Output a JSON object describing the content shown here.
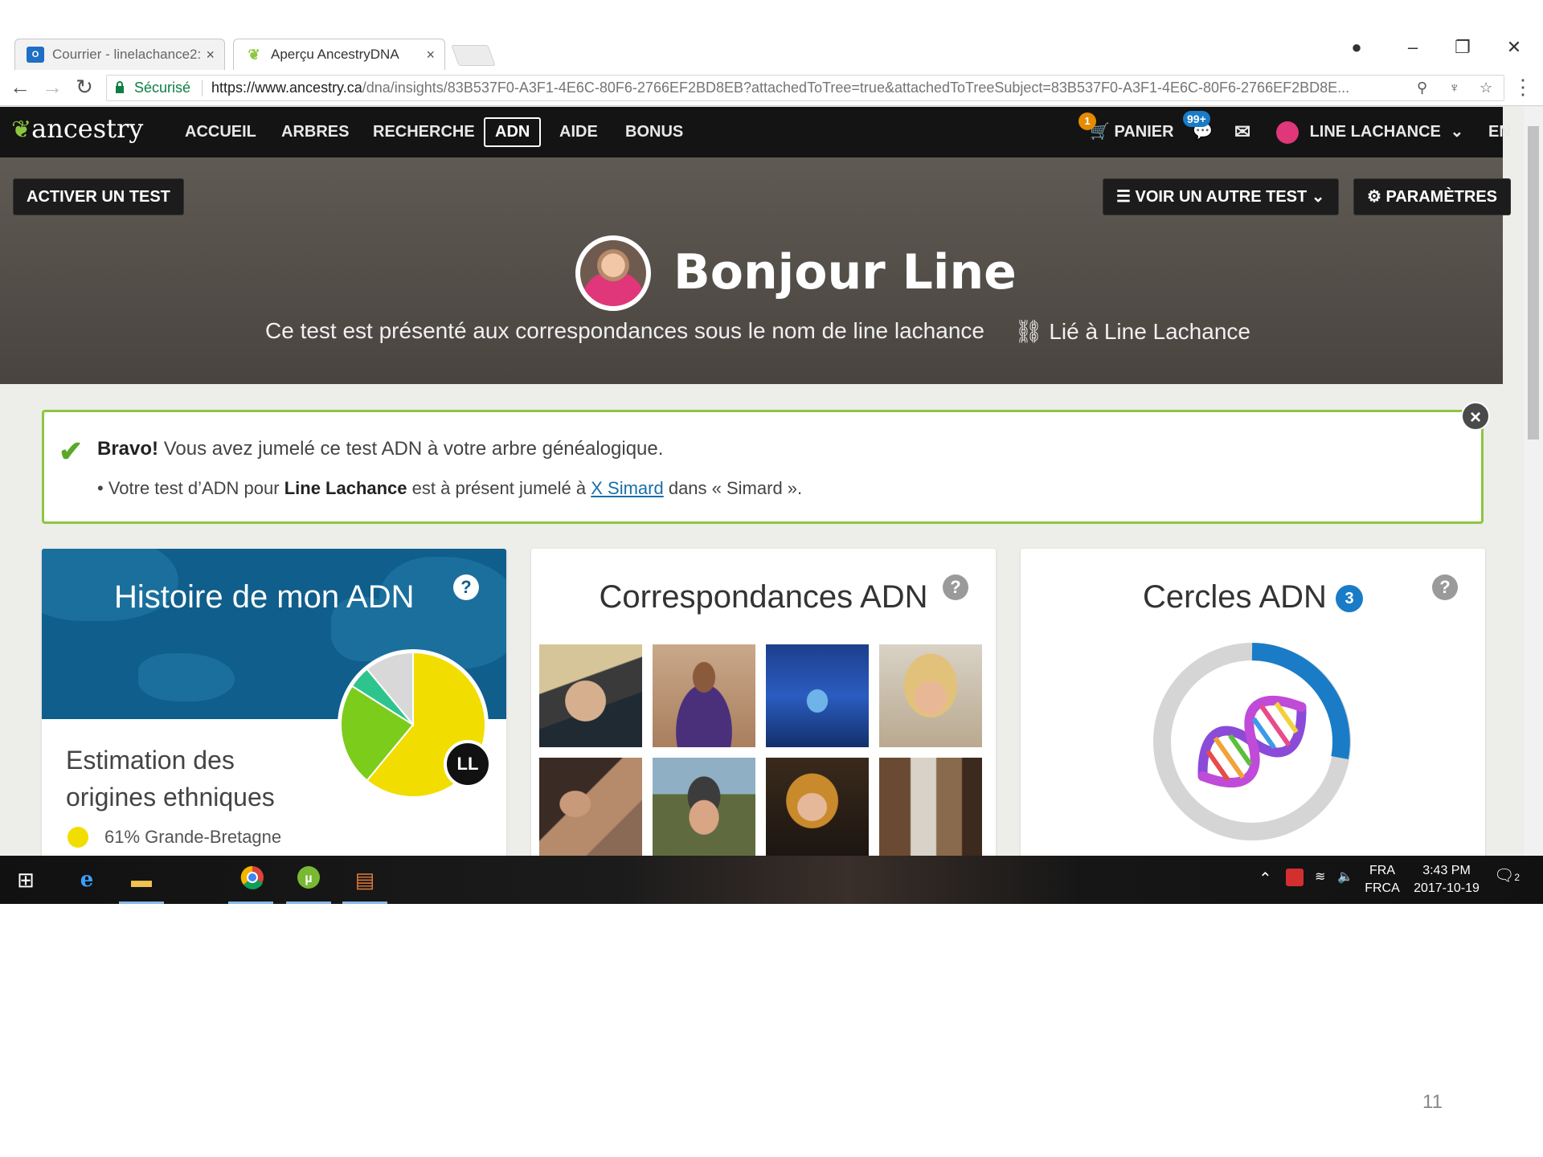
{
  "browser": {
    "tabs": [
      {
        "label": "Courrier - linelachance2:",
        "icon": "outlook-icon",
        "active": false
      },
      {
        "label": "Aperçu AncestryDNA",
        "icon": "ancestry-leaf-icon",
        "active": true
      }
    ],
    "secure_label": "Sécurisé",
    "url_host": "https://www.ancestry.ca",
    "url_rest": "/dna/insights/83B537F0-A3F1-4E6C-80F6-2766EF2BD8EB?attachedToTree=true&attachedToTreeSubject=83B537F0-A3F1-4E6C-80F6-2766EF2BD8E..."
  },
  "header": {
    "logo": "ancestry",
    "nav": [
      "ACCUEIL",
      "ARBRES",
      "RECHERCHE",
      "ADN",
      "AIDE",
      "BONUS"
    ],
    "active_nav": "ADN",
    "cart_label": "PANIER",
    "cart_badge": "1",
    "messages_badge": "99+",
    "user_name": "LINE LACHANCE",
    "language": "EN"
  },
  "hero": {
    "activate_button": "ACTIVER UN TEST",
    "other_test_button": "VOIR UN AUTRE TEST",
    "settings_button": "PARAMÈTRES",
    "greeting": "Bonjour Line",
    "subtitle": "Ce test est présenté aux correspondances sous le nom de line lachance",
    "linked_label": "Lié à Line Lachance"
  },
  "alert": {
    "bold": "Bravo!",
    "line1_rest": " Vous avez jumelé ce test ADN à votre arbre généalogique.",
    "line2_prefix": "• Votre test d’ADN pour ",
    "line2_name": "Line Lachance",
    "line2_mid": " est à présent jumelé à ",
    "line2_link": "X Simard",
    "line2_suffix": " dans « Simard »."
  },
  "cards": {
    "history": {
      "title": "Histoire de mon ADN",
      "subtitle": "Estimation des origines ethniques",
      "initials": "LL",
      "legend": "61% Grande-Bretagne",
      "pie": [
        {
          "label": "Grande-Bretagne",
          "value": 61,
          "color": "#f2dd00"
        },
        {
          "label": "",
          "value": 23,
          "color": "#7ccc1c"
        },
        {
          "label": "",
          "value": 5,
          "color": "#2ec48e"
        },
        {
          "label": "",
          "value": 11,
          "color": "#d8d8d8"
        }
      ]
    },
    "matches": {
      "title": "Correspondances ADN"
    },
    "circles": {
      "title": "Cercles ADN",
      "count": "3"
    }
  },
  "taskbar": {
    "lang_top": "FRA",
    "lang_bottom": "FRCA",
    "time": "3:43 PM",
    "date": "2017-10-19",
    "notifications": "2"
  },
  "slide_number": "11"
}
